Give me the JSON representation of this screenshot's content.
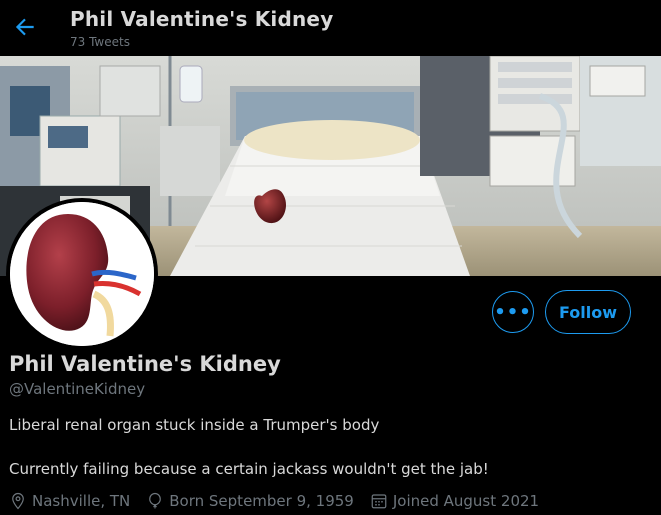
{
  "header": {
    "title": "Phil Valentine's Kidney",
    "tweet_count": "73 Tweets"
  },
  "profile": {
    "name": "Phil Valentine's Kidney",
    "handle": "@ValentineKidney",
    "bio_line1": "Liberal renal organ stuck inside a Trumper's body",
    "bio_line2": "Currently failing because a certain jackass wouldn't get the jab!",
    "location": "Nashville, TN",
    "birthday": "Born September 9, 1959",
    "joined": "Joined August 2021"
  },
  "actions": {
    "more_label": "•••",
    "follow_label": "Follow"
  },
  "icons": {
    "back": "arrow-left-icon",
    "location": "map-pin-icon",
    "birthday": "balloon-icon",
    "joined": "calendar-icon"
  },
  "colors": {
    "accent": "#1d9bf0",
    "background": "#000000",
    "text": "#d9d9d9",
    "muted": "#6e767d"
  }
}
